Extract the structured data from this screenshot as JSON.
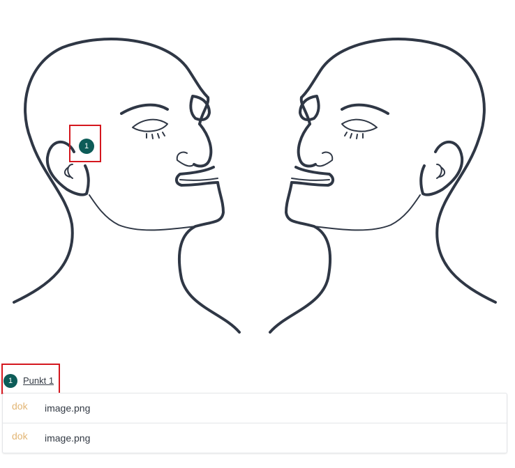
{
  "image_marker": {
    "number": "1"
  },
  "points": [
    {
      "number": "1",
      "label": "Punkt 1"
    }
  ],
  "attachments": [
    {
      "type": "dok",
      "name": "image.png"
    },
    {
      "type": "dok",
      "name": "image.png"
    }
  ],
  "colors": {
    "marker": "#0d5c58",
    "highlight": "#d4171e",
    "file_type": "#e2b574",
    "line_art": "#2f3745"
  },
  "icons": {
    "image": "face-profiles-line-art"
  }
}
